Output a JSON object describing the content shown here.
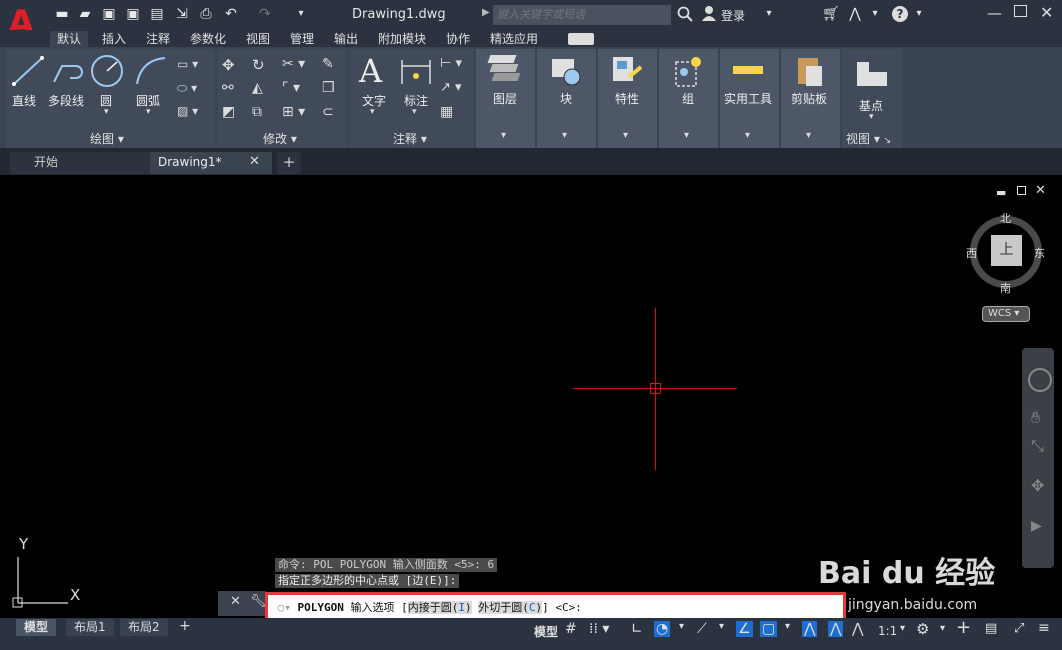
{
  "app": {
    "document_title": "Drawing1.dwg",
    "search_placeholder": "键入关键字或短语",
    "login_label": "登录"
  },
  "ribbon_tabs": [
    "默认",
    "插入",
    "注释",
    "参数化",
    "视图",
    "管理",
    "输出",
    "附加模块",
    "协作",
    "精选应用"
  ],
  "panels": {
    "draw": {
      "title": "绘图",
      "line": "直线",
      "polyline": "多段线",
      "circle": "圆",
      "arc": "圆弧"
    },
    "modify": {
      "title": "修改"
    },
    "annotation": {
      "title": "注释",
      "text": "文字",
      "dimension": "标注"
    },
    "layers": "图层",
    "block": "块",
    "properties": "特性",
    "groups": "组",
    "utilities": "实用工具",
    "clipboard": "剪贴板",
    "view": {
      "title": "视图",
      "base": "基点"
    }
  },
  "doc_tabs": {
    "home": "开始",
    "drawing": "Drawing1*"
  },
  "viewcube": {
    "north": "北",
    "south": "南",
    "east": "东",
    "west": "西",
    "face": "上",
    "wcs": "WCS"
  },
  "ucs": {
    "x": "X",
    "y": "Y"
  },
  "command": {
    "history1": "命令: POL POLYGON 输入侧面数 <5>: 6",
    "history2": "指定正多边形的中心点或 [边(E)]:",
    "name": "POLYGON",
    "prompt": " 输入选项 [",
    "opt1": "内接于圆(",
    "opt1_key": "I",
    "opt2": "外切于圆(",
    "opt2_key": "C",
    "suffix": "] <C>:"
  },
  "layout_tabs": {
    "model": "模型",
    "layout1": "布局1",
    "layout2": "布局2"
  },
  "status": {
    "model": "模型",
    "scale": "1:1"
  },
  "watermark": {
    "logo": "Bai du 经验",
    "url": "jingyan.baidu.com"
  },
  "colors": {
    "accent_red": "#e21d26",
    "crosshair": "#e01010",
    "highlight": "#e23a3a"
  }
}
